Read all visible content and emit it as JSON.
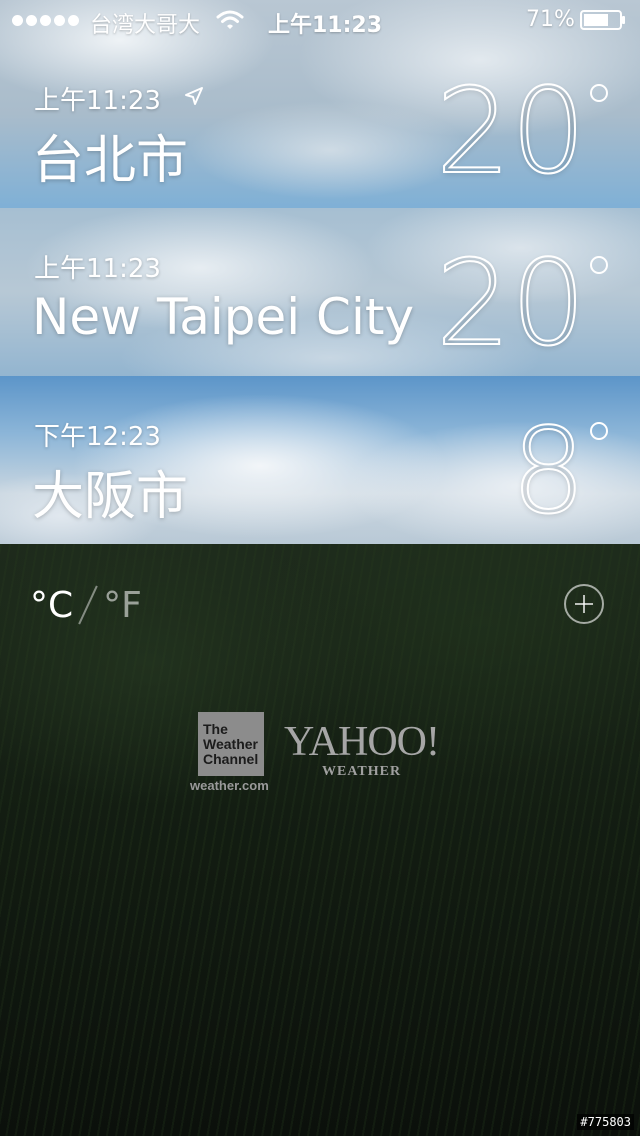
{
  "status_bar": {
    "carrier": "台湾大哥大",
    "time": "上午11:23",
    "battery_percent": "71%",
    "battery_level": 0.71,
    "signal_dots": 5,
    "icons": [
      "signal-dots-icon",
      "wifi-icon",
      "battery-icon"
    ]
  },
  "cities": [
    {
      "local_time": "上午11:23",
      "name": "台北市",
      "temperature": "20",
      "is_current_location": true,
      "icon": "location-arrow-icon"
    },
    {
      "local_time": "上午11:23",
      "name": "New Taipei City",
      "temperature": "20",
      "is_current_location": false
    },
    {
      "local_time": "下午12:23",
      "name": "大阪市",
      "temperature": "8",
      "is_current_location": false
    }
  ],
  "controls": {
    "unit_celsius": "°C",
    "unit_fahrenheit": "°F",
    "selected_unit": "°C",
    "add_icon": "plus-circle-icon"
  },
  "credits": {
    "twc_line1": "The",
    "twc_line2": "Weather",
    "twc_line3": "Channel",
    "twc_url": "weather.com",
    "yahoo": "YAHOO!",
    "yahoo_sub": "WEATHER"
  },
  "watermark": "#775803"
}
